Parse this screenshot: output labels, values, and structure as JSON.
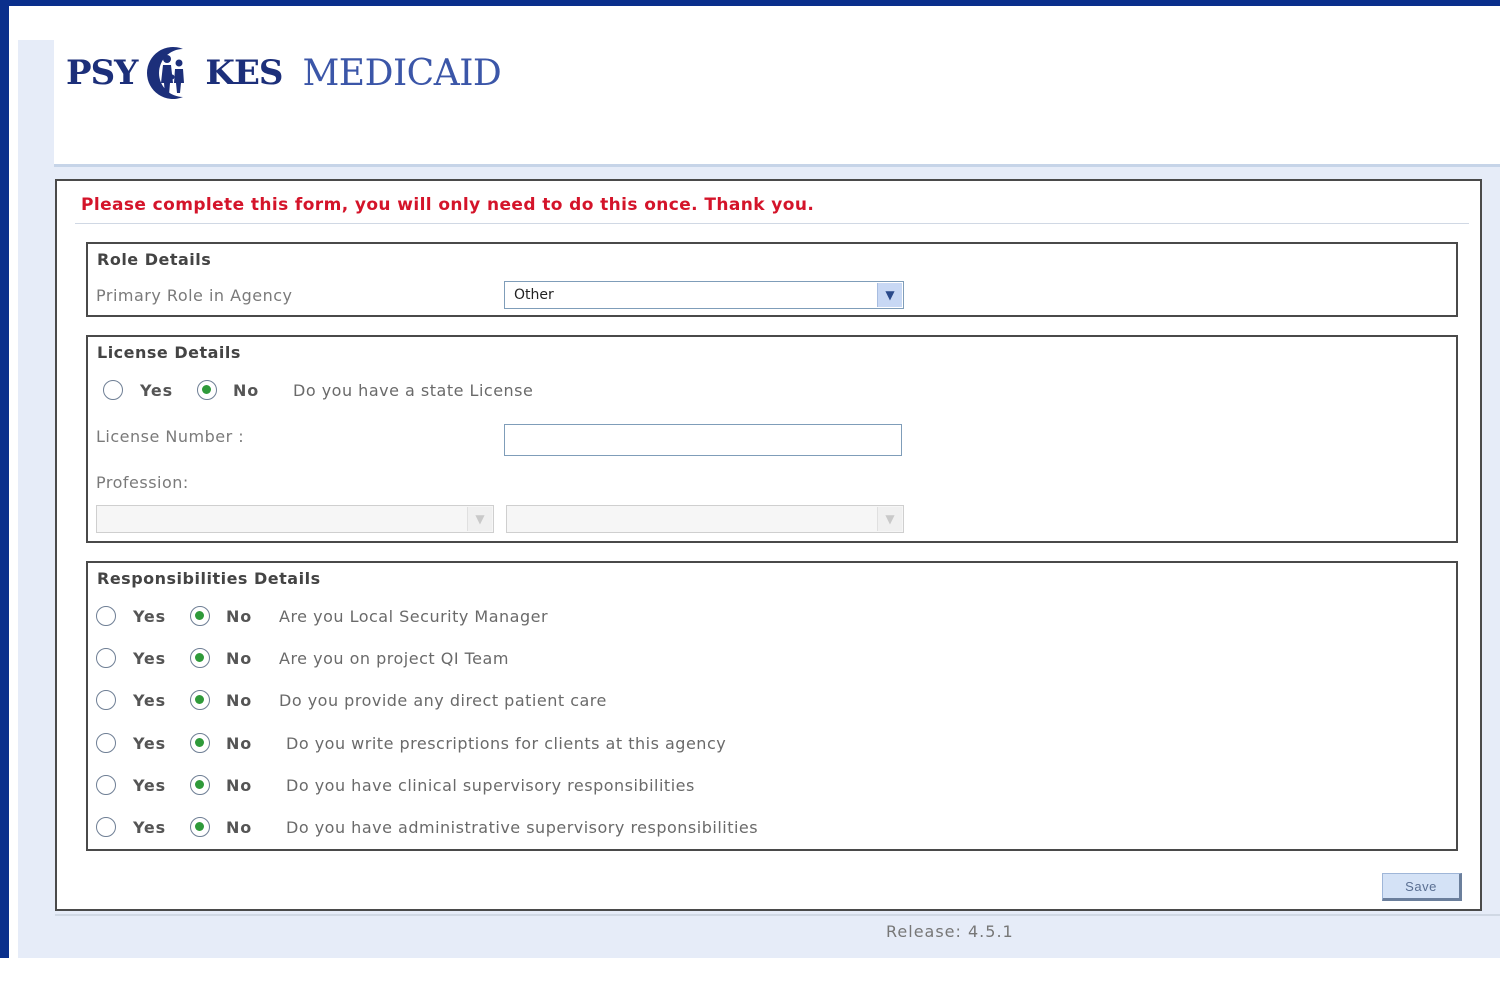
{
  "logo": {
    "part1": "PSY",
    "part2": "KES",
    "part3": "MEDICAID"
  },
  "intro_text": "Please complete this form, you will only need to do this once. Thank you.",
  "role_section": {
    "title": "Role Details",
    "primary_role_label": "Primary Role in Agency",
    "primary_role_value": "Other"
  },
  "license_section": {
    "title": "License Details",
    "yes_label": "Yes",
    "no_label": "No",
    "question": "Do you have a state License",
    "selected": "No",
    "license_number_label": "License Number :",
    "license_number_value": "",
    "profession_label": "Profession:",
    "profession_value_1": "",
    "profession_value_2": ""
  },
  "responsibilities_section": {
    "title": "Responsibilities Details",
    "yes_label": "Yes",
    "no_label": "No",
    "questions": [
      {
        "text": "Are you Local Security Manager",
        "selected": "No"
      },
      {
        "text": "Are you on project QI Team",
        "selected": "No"
      },
      {
        "text": "Do you provide any direct patient care",
        "selected": "No"
      },
      {
        "text": "Do you write prescriptions for clients at this agency",
        "selected": "No"
      },
      {
        "text": "Do you have clinical supervisory responsibilities",
        "selected": "No"
      },
      {
        "text": "Do you have administrative supervisory responsibilities",
        "selected": "No"
      }
    ]
  },
  "save_label": "Save",
  "release_text": "Release: 4.5.1",
  "colors": {
    "frame": "#0a2f8c",
    "intro": "#d4142a",
    "radio_selected": "#2f9a3a"
  }
}
